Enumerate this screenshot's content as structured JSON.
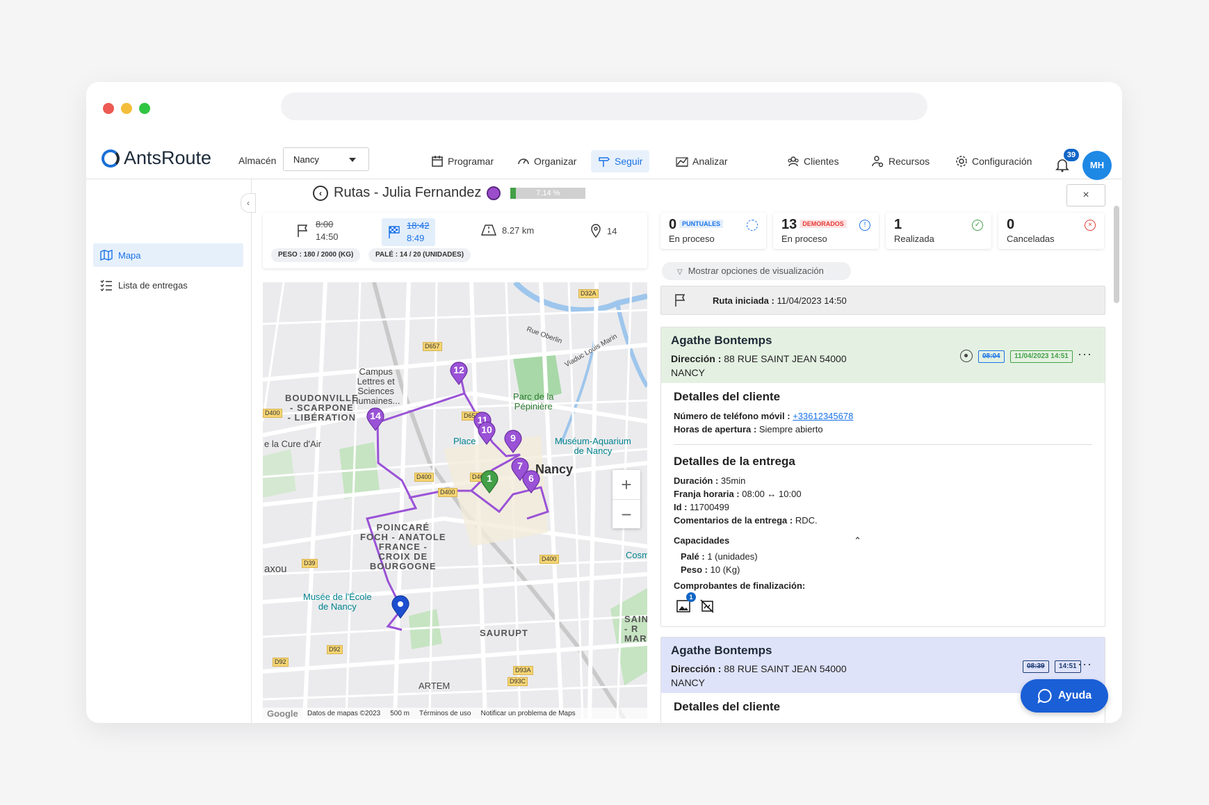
{
  "app": {
    "logo_text": "AntsRoute",
    "notifications": "39",
    "avatar": "MH"
  },
  "almacen": {
    "label": "Almacén",
    "value": "Nancy"
  },
  "nav": [
    {
      "label": "Programar",
      "icon": "calendar-icon"
    },
    {
      "label": "Organizar",
      "icon": "gauge-icon"
    },
    {
      "label": "Seguir",
      "icon": "signpost-icon"
    },
    {
      "label": "Analizar",
      "icon": "chart-icon"
    },
    {
      "label": "Clientes",
      "icon": "users-icon"
    },
    {
      "label": "Recursos",
      "icon": "resources-icon"
    },
    {
      "label": "Configuración",
      "icon": "gear-icon"
    }
  ],
  "sidebar": {
    "items": [
      {
        "label": "Mapa"
      },
      {
        "label": "Lista de entregas"
      }
    ]
  },
  "route": {
    "title": "Rutas - Julia Fernandez",
    "progress_text": "7.14 %",
    "progress_value": 0.0714,
    "close": "×",
    "start_planned": "8:00",
    "start_real": "14:50",
    "end_planned": "18:42",
    "end_real": "8:49",
    "distance": "8.27 km",
    "stops": "14",
    "peso": "PESO : 180 / 2000 (KG)",
    "pale": "PALÉ : 14 / 20 (UNIDADES)"
  },
  "stats": [
    {
      "n": "0",
      "tag": "PUNTUALES",
      "label": "En proceso",
      "color": "#1a73e8"
    },
    {
      "n": "13",
      "tag": "DEMORADOS",
      "label": "En proceso",
      "color": "#e53935"
    },
    {
      "n": "1",
      "tag": "",
      "label": "Realizada",
      "color": "#43a047"
    },
    {
      "n": "0",
      "tag": "",
      "label": "Canceladas",
      "color": "#e53935"
    }
  ],
  "filter": {
    "label": "Mostrar opciones de visualización"
  },
  "started": {
    "label": "Ruta iniciada :",
    "value": "11/04/2023 14:50"
  },
  "delivery1": {
    "name": "Agathe Bontemps",
    "dir_label": "Dirección :",
    "dir_value": "88 RUE SAINT JEAN 54000",
    "city": "NANCY",
    "planned": "08:04",
    "actual": "11/04/2023 14:51",
    "client_title": "Detalles del cliente",
    "phone_label": "Número de teléfono móvil :",
    "phone": "+33612345678",
    "hours_label": "Horas de apertura :",
    "hours": "Siempre abierto",
    "delivery_title": "Detalles de la entrega",
    "dur_label": "Duración :",
    "dur": "35min",
    "slot_label": "Franja horaria :",
    "slot": "08:00 ↔ 10:00",
    "id_label": "Id :",
    "id": "11700499",
    "comment_label": "Comentarios de la entrega :",
    "comment": "RDC.",
    "cap_title": "Capacidades",
    "pale_label": "Palé :",
    "pale": "1 (unidades)",
    "peso_label": "Peso :",
    "peso": "10 (Kg)",
    "proof_title": "Comprobantes de finalización:",
    "proof_badge": "1"
  },
  "delivery2": {
    "name": "Agathe Bontemps",
    "dir_label": "Dirección :",
    "dir_value": "88 RUE SAINT JEAN 54000",
    "city": "NANCY",
    "planned": "08:39",
    "actual": "14:51",
    "client_title": "Detalles del cliente"
  },
  "map": {
    "labels": {
      "campus": "Campus\nLettres et\nSciences\nHumaines...",
      "boudonville": "BOUDONVILLE\n- SCARPONE\n- LIBÉRATION",
      "pepiniere": "Parc de la\nPépinière",
      "museum": "Muséum-Aquarium\nde Nancy",
      "nancy": "Nancy",
      "place": "Place",
      "poincare": "POINCARÉ\nFOCH - ANATOLE\nFRANCE -\nCROIX DE\nBOURGOGNE",
      "musee": "Musée de l'École\nde Nancy",
      "saurupt": "SAURUPT",
      "artem": "ARTEM",
      "cure": "e la Cure d'Air",
      "laxou": "axou",
      "saint": "SAIN\n- R\nMAR",
      "cosm": "Cosm",
      "oberlin": "Rue Oberlin",
      "viaduc": "Viaduc Louis Marin"
    },
    "roads": [
      "D32A",
      "D657",
      "D400",
      "D400",
      "D657",
      "D400",
      "D400",
      "D39",
      "D400",
      "D92",
      "D92",
      "D93A",
      "D93C"
    ],
    "markers": [
      "12",
      "14",
      "11",
      "10",
      "9",
      "7",
      "6",
      "1"
    ],
    "footer": [
      "Datos de mapas ©2023",
      "500 m",
      "Términos de uso",
      "Notificar un problema de Maps"
    ],
    "google": "Google",
    "zoom_in": "+",
    "zoom_out": "−"
  },
  "help": {
    "label": "Ayuda"
  }
}
